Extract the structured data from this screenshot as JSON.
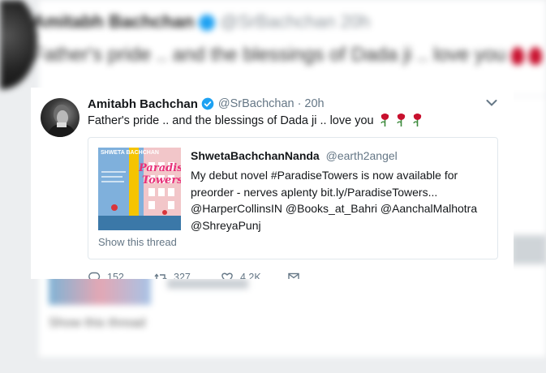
{
  "background_tweet": {
    "name": "Amitabh Bachchan",
    "handle": "@SrBachchan",
    "time": "20h",
    "text": "Father's pride .. and the blessings of Dada ji .. love you",
    "show_thread": "Show this thread"
  },
  "tweet": {
    "display_name": "Amitabh Bachchan",
    "handle": "@SrBachchan",
    "separator": "·",
    "time": "20h",
    "text": "Father's pride .. and the blessings of Dada ji .. love you",
    "emoji_icons": [
      "rose-icon",
      "rose-icon",
      "rose-icon"
    ],
    "quoted": {
      "display_name": "ShwetaBachchanNanda",
      "handle": "@earth2angel",
      "text_lines": [
        "My debut novel #ParadiseTowers is now available for",
        "preorder - nerves aplenty  bit.ly/ParadiseTowers...",
        "@HarperCollinsIN @Books_at_Bahri @AanchalMalhotra",
        "@ShreyaPunj"
      ],
      "book_cover": {
        "author": "SHWETA BACHCHAN",
        "title_line1": "Paradise",
        "title_line2": "Towers"
      },
      "show_thread": "Show this thread"
    },
    "actions": {
      "reply_count": "152",
      "retweet_count": "327",
      "like_count": "4.2K"
    }
  },
  "colors": {
    "accent": "#1da1f2",
    "muted_text": "#657786",
    "rose": "#c8102e",
    "border": "#e1e8ed"
  }
}
